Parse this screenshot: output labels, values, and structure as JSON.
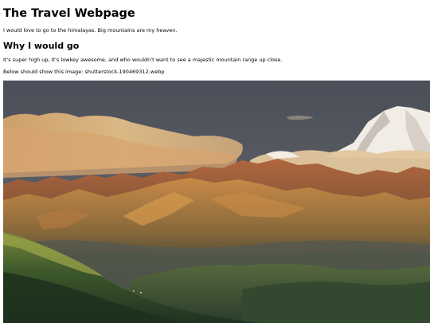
{
  "heading": "The Travel Webpage",
  "intro": "I would love to go to the himalayas. Big mountains are my heaven.",
  "section": {
    "title": "Why I would go",
    "text": "It's super high up, It's lowkey awesome, and who wouldn't want to see a majestic mountain range up close."
  },
  "image_caption": "Below should show this image: shutterstock-190469312.webp",
  "image": {
    "subject": "himalayan-mountain-range-photo"
  }
}
